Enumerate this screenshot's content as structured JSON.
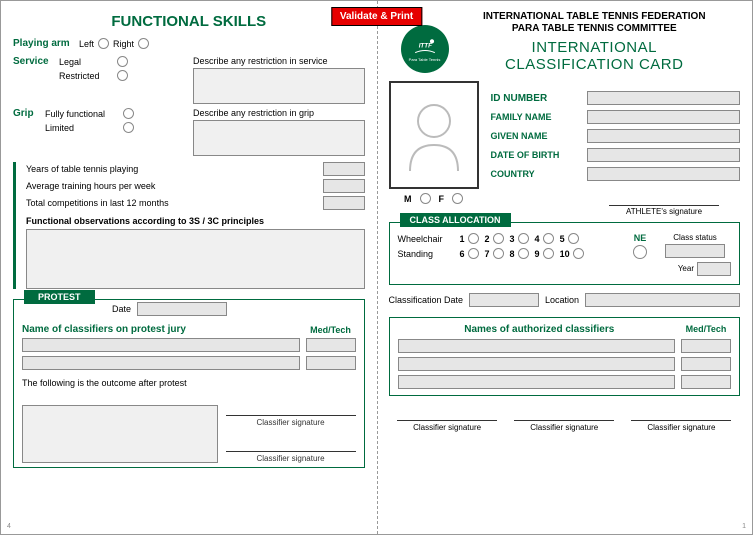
{
  "validate_btn": "Validate & Print",
  "left": {
    "title": "FUNCTIONAL SKILLS",
    "playing_arm": {
      "label": "Playing arm",
      "opt_left": "Left",
      "opt_right": "Right"
    },
    "service": {
      "label": "Service",
      "opt1": "Legal",
      "opt2": "Restricted",
      "describe": "Describe any restriction in service"
    },
    "grip": {
      "label": "Grip",
      "opt1": "Fully functional",
      "opt2": "Limited",
      "describe": "Describe any restriction in grip"
    },
    "stats": {
      "years": "Years of table tennis playing",
      "hours": "Average training hours per week",
      "comps": "Total competitions in last 12 months"
    },
    "func_obs": "Functional observations according to 3S / 3C principles",
    "protest": {
      "tab": "PROTEST",
      "date_lbl": "Date",
      "jury_lbl": "Name of classifiers on protest jury",
      "medtech": "Med/Tech",
      "outcome_lbl": "The following is the outcome after protest",
      "sig": "Classifier signature"
    }
  },
  "right": {
    "org1": "INTERNATIONAL TABLE TENNIS FEDERATION",
    "org2": "PARA TABLE TENNIS COMMITTEE",
    "title1": "INTERNATIONAL",
    "title2": "CLASSIFICATION CARD",
    "badge_text": "Para Table Tennis",
    "fields": {
      "id": "ID NUMBER",
      "family": "FAMILY NAME",
      "given": "GIVEN NAME",
      "dob": "DATE OF BIRTH",
      "country": "COUNTRY"
    },
    "gender": {
      "m": "M",
      "f": "F"
    },
    "ath_sig": "ATHLETE's signature",
    "alloc": {
      "tab": "CLASS ALLOCATION",
      "wheelchair": "Wheelchair",
      "standing": "Standing",
      "nums_top": [
        "1",
        "2",
        "3",
        "4",
        "5"
      ],
      "nums_bot": [
        "6",
        "7",
        "8",
        "9",
        "10"
      ],
      "ne": "NE",
      "class_status": "Class status",
      "year": "Year"
    },
    "class_date": "Classification Date",
    "location": "Location",
    "names": {
      "title": "Names of authorized classifiers",
      "medtech": "Med/Tech"
    },
    "bot_sig": "Classifier signature"
  },
  "page_left": "4",
  "page_right": "1"
}
